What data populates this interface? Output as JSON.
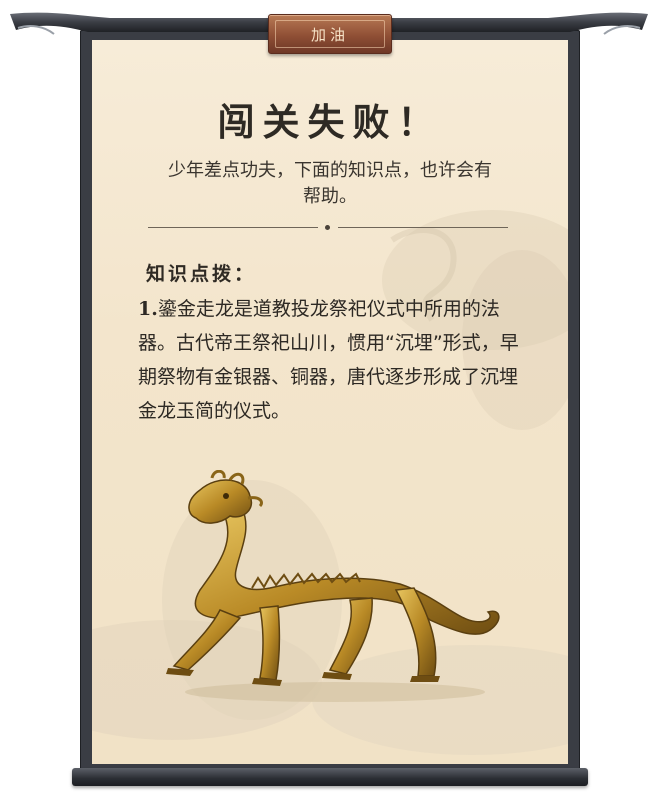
{
  "badge": {
    "label": "加油"
  },
  "result": {
    "title": "闯关失败",
    "exclamation": "！",
    "message": "少年差点功夫，下面的知识点，也许会有帮助。"
  },
  "knowledge": {
    "heading": "知识点拨：",
    "items": [
      {
        "number": "1.",
        "text": "鎏金走龙是道教投龙祭祀仪式中所用的法器。古代帝王祭祀山川，惯用“沉埋”形式，早期祭物有金银器、铜器，唐代逐步形成了沉埋金龙玉简的仪式。"
      }
    ]
  },
  "illustration": {
    "subject": "gilded-walking-dragon"
  },
  "colors": {
    "paper": "#f3e5cc",
    "frame": "#3a3d44",
    "badge": "#8f4f35",
    "text": "#2e2a24",
    "dragon_gold": "#c9a23a"
  }
}
